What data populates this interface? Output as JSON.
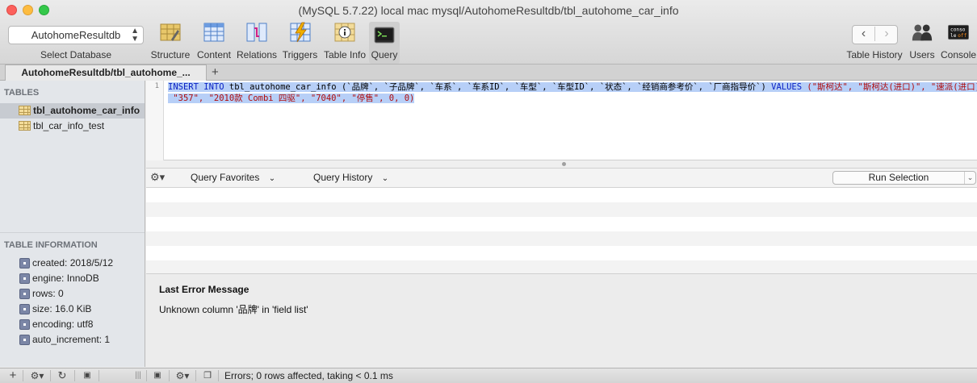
{
  "window": {
    "title": "(MySQL 5.7.22) local mac mysql/AutohomeResultdb/tbl_autohome_car_info"
  },
  "database_selector": {
    "value": "AutohomeResultdb",
    "caption": "Select Database"
  },
  "toolbar": {
    "items": [
      {
        "label": "Structure",
        "icon": "structure-icon"
      },
      {
        "label": "Content",
        "icon": "content-icon"
      },
      {
        "label": "Relations",
        "icon": "relations-icon"
      },
      {
        "label": "Triggers",
        "icon": "triggers-icon"
      },
      {
        "label": "Table Info",
        "icon": "table-info-icon"
      },
      {
        "label": "Query",
        "icon": "query-icon",
        "active": true
      }
    ],
    "right": [
      {
        "label": "Table History"
      },
      {
        "label": "Users"
      },
      {
        "label": "Console"
      }
    ],
    "console_badge": "conso\nle off"
  },
  "tab": {
    "label": "AutohomeResultdb/tbl_autohome_...",
    "add": "+"
  },
  "sidebar": {
    "tables_header": "TABLES",
    "tables": [
      "tbl_autohome_car_info",
      "tbl_car_info_test"
    ],
    "info_header": "TABLE INFORMATION",
    "info": [
      "created: 2018/5/12",
      "engine: InnoDB",
      "rows: 0",
      "size: 16.0 KiB",
      "encoding: utf8",
      "auto_increment: 1"
    ]
  },
  "editor": {
    "line_number": "1",
    "line1_kw1": "INSERT INTO",
    "line1_table": " tbl_autohome_car_info (`品牌`, `子品牌`, `车系`, `车系ID`, `车型`, `车型ID`, `状态`, `经销商参考价`, `厂商指导价`) ",
    "line1_kw2": "VALUES",
    "line1_vals": " (\"斯柯达\", \"斯柯达(进口)\", \"速派(进口)\",",
    "line2_vals": " \"357\", \"2010款 Combi 四驱\", \"7040\", \"停售\", 0, 0)"
  },
  "query_bar": {
    "gear": "⚙▾",
    "favorites": "Query Favorites",
    "history": "Query History",
    "run": "Run Selection"
  },
  "error": {
    "title": "Last Error Message",
    "message": "Unknown column '品牌' in 'field list'"
  },
  "status": {
    "text": "Errors; 0 rows affected, taking < 0.1 ms"
  },
  "colors": {
    "selection": "#b7cff7",
    "keyword": "#0b22c4",
    "string": "#b10c0c"
  }
}
